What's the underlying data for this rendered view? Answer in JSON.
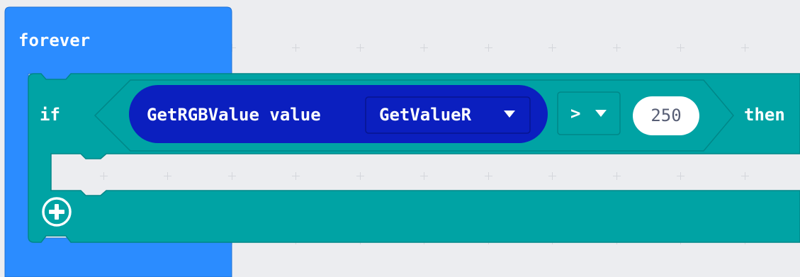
{
  "colors": {
    "workspace_bg": "#ecedf0",
    "grid_mark": "#d4d6db",
    "loops_block": "#2b8cff",
    "logic_block": "#00a3a4",
    "reporter_block": "#0b1fbf",
    "number_slot_bg": "#ffffff",
    "text": "#ffffff"
  },
  "forever_block": {
    "label": "forever"
  },
  "if_block": {
    "label": "if",
    "then_label": "then",
    "add_button_icon": "plus-circle-icon"
  },
  "condition": {
    "reporter_label": "GetRGBValue value",
    "dropdown_value": "GetValueR",
    "dropdown_icon": "dropdown-triangle-icon",
    "operator_value": ">",
    "operator_icon": "dropdown-triangle-icon",
    "number_value": "250"
  }
}
